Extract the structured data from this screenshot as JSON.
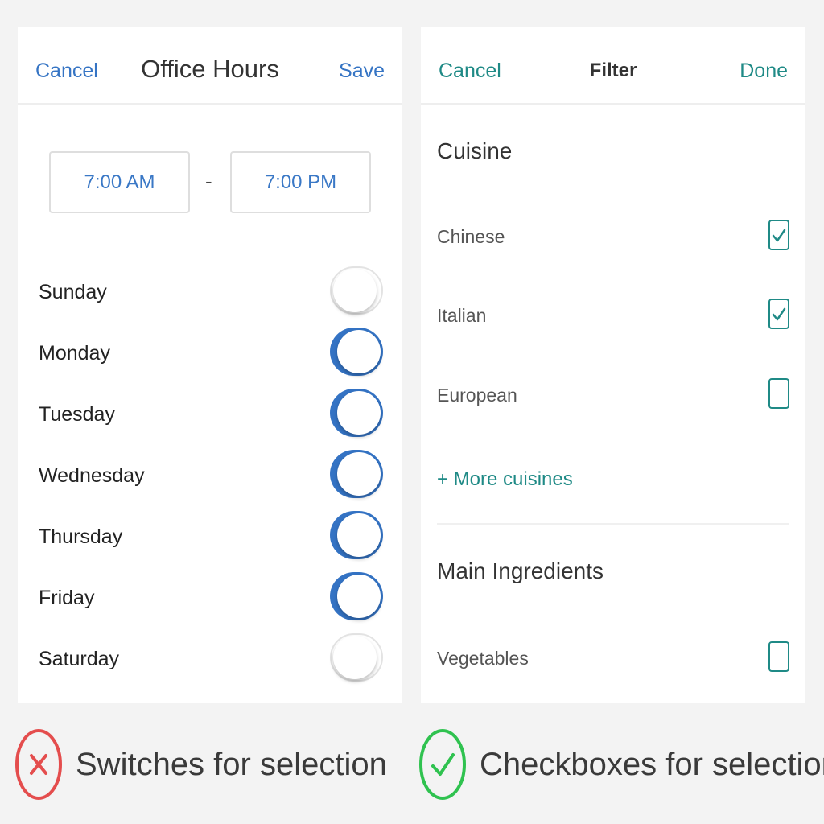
{
  "office_hours": {
    "cancel_label": "Cancel",
    "title": "Office Hours",
    "save_label": "Save",
    "start_time": "7:00 AM",
    "separator": "-",
    "end_time": "7:00 PM",
    "days": [
      {
        "label": "Sunday",
        "on": false
      },
      {
        "label": "Monday",
        "on": true
      },
      {
        "label": "Tuesday",
        "on": true
      },
      {
        "label": "Wednesday",
        "on": true
      },
      {
        "label": "Thursday",
        "on": true
      },
      {
        "label": "Friday",
        "on": true
      },
      {
        "label": "Saturday",
        "on": false
      }
    ]
  },
  "filter": {
    "cancel_label": "Cancel",
    "title": "Filter",
    "done_label": "Done",
    "cuisine_heading": "Cuisine",
    "cuisines": [
      {
        "label": "Chinese",
        "checked": true
      },
      {
        "label": "Italian",
        "checked": true
      },
      {
        "label": "European",
        "checked": false
      }
    ],
    "more_cuisines_label": "+ More cuisines",
    "ingredients_heading": "Main Ingredients",
    "ingredients": [
      {
        "label": "Vegetables",
        "checked": false
      }
    ]
  },
  "captions": {
    "bad": {
      "text": "Switches for selection",
      "icon": "x-circle-icon",
      "color": "#e44d4d"
    },
    "good": {
      "text": "Checkboxes for selection",
      "icon": "check-circle-icon",
      "color": "#2fc24f"
    }
  },
  "colors": {
    "switch_accent": "#3473c4",
    "checkbox_accent": "#1f8a86"
  }
}
